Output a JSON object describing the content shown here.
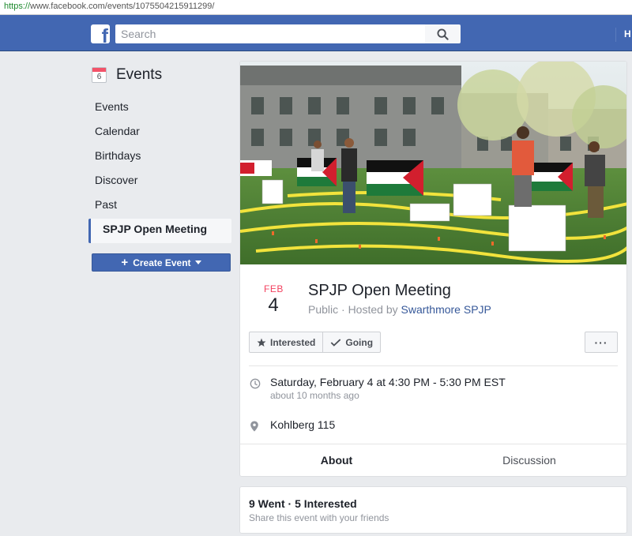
{
  "browser": {
    "url_scheme": "https://",
    "url_rest": "www.facebook.com/events/1075504215911299/"
  },
  "topbar": {
    "logo_letter": "f",
    "search_placeholder": "Search",
    "home_label": "H"
  },
  "sidebar": {
    "icon_day": "6",
    "title": "Events",
    "items": [
      {
        "label": "Events"
      },
      {
        "label": "Calendar"
      },
      {
        "label": "Birthdays"
      },
      {
        "label": "Discover"
      },
      {
        "label": "Past"
      },
      {
        "label": "SPJP Open Meeting"
      }
    ],
    "active_index": 5,
    "create_label": "Create Event"
  },
  "event": {
    "month": "FEB",
    "day": "4",
    "title": "SPJP Open Meeting",
    "visibility": "Public · Hosted by ",
    "host": "Swarthmore SPJP",
    "interested_label": "Interested",
    "going_label": "Going",
    "more_label": "···",
    "datetime": "Saturday, February 4 at 4:30 PM - 5:30 PM EST",
    "datetime_relative": "about 10 months ago",
    "location": "Kohlberg 115",
    "tabs": [
      {
        "label": "About",
        "active": true
      },
      {
        "label": "Discussion",
        "active": false
      }
    ]
  },
  "stats": {
    "summary": "9 Went · 5 Interested",
    "share_text": "Share this event with your friends"
  },
  "colors": {
    "brand_blue": "#4267b2",
    "link_blue": "#365899",
    "date_red": "#f3425f",
    "background": "#e9ebee"
  }
}
